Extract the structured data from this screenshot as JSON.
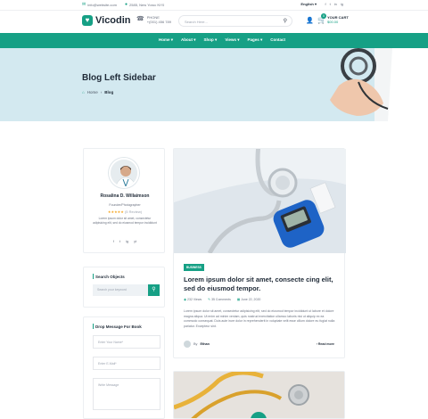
{
  "topbar": {
    "email": "info@website.com",
    "address": "2585, New Yoroc NY0",
    "language": "English",
    "social": [
      "f",
      "t",
      "in",
      "ig"
    ]
  },
  "header": {
    "logo": "Vicodin",
    "phone_label": "PHONE",
    "phone_number": "+(001) 456 789",
    "search_placeholder": "Search Here...",
    "cart_label": "YOUR CART",
    "cart_amount": "$00.00",
    "cart_count": "0"
  },
  "nav": {
    "items": [
      "Home",
      "About",
      "Shop",
      "Views",
      "Pages",
      "Contact"
    ]
  },
  "hero": {
    "title": "Blog Left Sidebar",
    "breadcrumb_home": "Home",
    "breadcrumb_current": "Blog"
  },
  "author": {
    "name": "Rosalina D. Willaimson",
    "role": "Founder/Photographer",
    "stars": "★★★★★",
    "reviews": "(5 Review)",
    "bio": "Lorem ipsum dolor sit amet, consectetur adipisicing elit, sed do eiusmod tempor incididunt",
    "social": [
      "f",
      "t",
      "ig",
      "yt"
    ]
  },
  "search_widget": {
    "title": "Search Objects",
    "placeholder": "Search your keyword"
  },
  "message_widget": {
    "title": "Drop Message For Book",
    "name_placeholder": "Enter Your Name*",
    "email_placeholder": "Enter E-Mail*",
    "message_placeholder": "Write Message"
  },
  "post": {
    "tag": "BUSINESS",
    "title": "Lorem ipsum dolor sit amet, consecte cing elit, sed do eiusmod tempor.",
    "views": "232 Views",
    "comments": "35 Comments",
    "date": "June 22, 2020",
    "excerpt": "Lorem ipsum dolor sit amet, consectetur adipisicing elit, sed do eiusmod tempor incididunt ut labore et dolore magna aliqua. Ut enim ad minim veniam, quis nostrud exercitation ullamco laboris nisi ut aliquip ex ea commodo consequat. Duis aute irure dolor in reprehenderit in voluptate velit esse cillum dolore eu fugiat nulla pariatur. Excepteur sint.",
    "author_prefix": "By",
    "author_name": "Ethan",
    "read_more": "Read more"
  },
  "colors": {
    "accent": "#16a085",
    "hero_bg": "#d3e9f0"
  }
}
